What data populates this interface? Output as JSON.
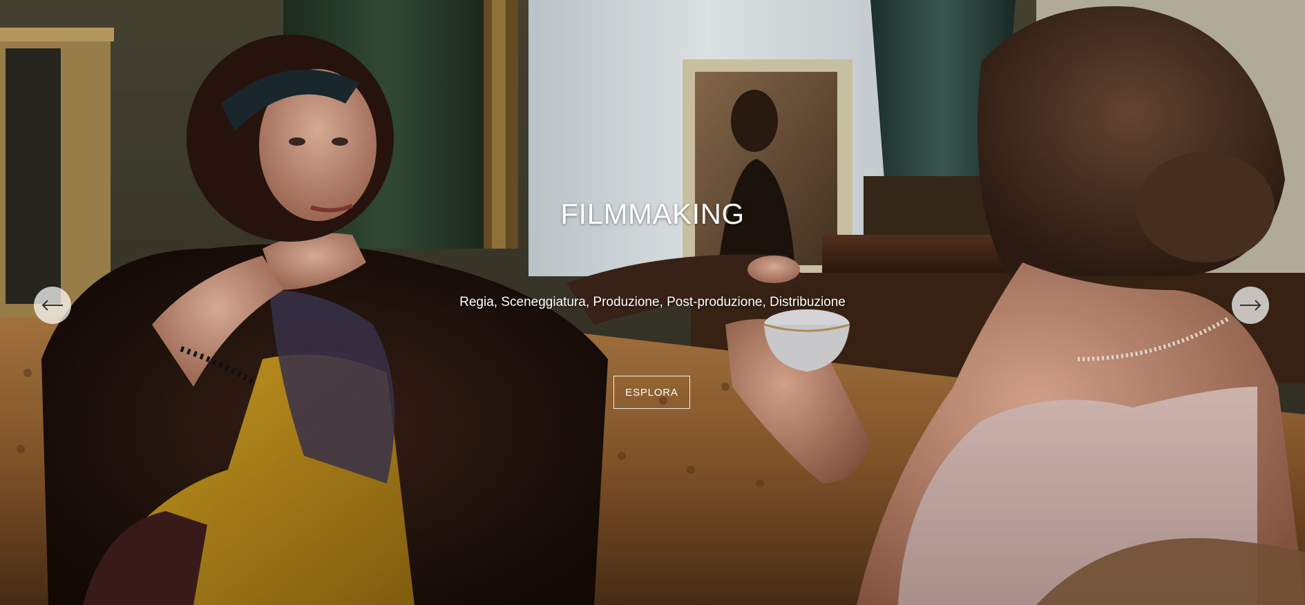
{
  "hero": {
    "title": "FILMMAKING",
    "subtitle": "Regia, Sceneggiatura, Produzione, Post-produzione, Distribuzione",
    "cta_label": "ESPLORA",
    "background_image": "film-still-two-women-on-leather-sofa"
  },
  "slider": {
    "prev_icon": "arrow-left-icon",
    "next_icon": "arrow-right-icon"
  },
  "colors": {
    "text": "#ffffff",
    "arrow_bg": "#ffffffb8",
    "arrow_icon": "#333333"
  }
}
